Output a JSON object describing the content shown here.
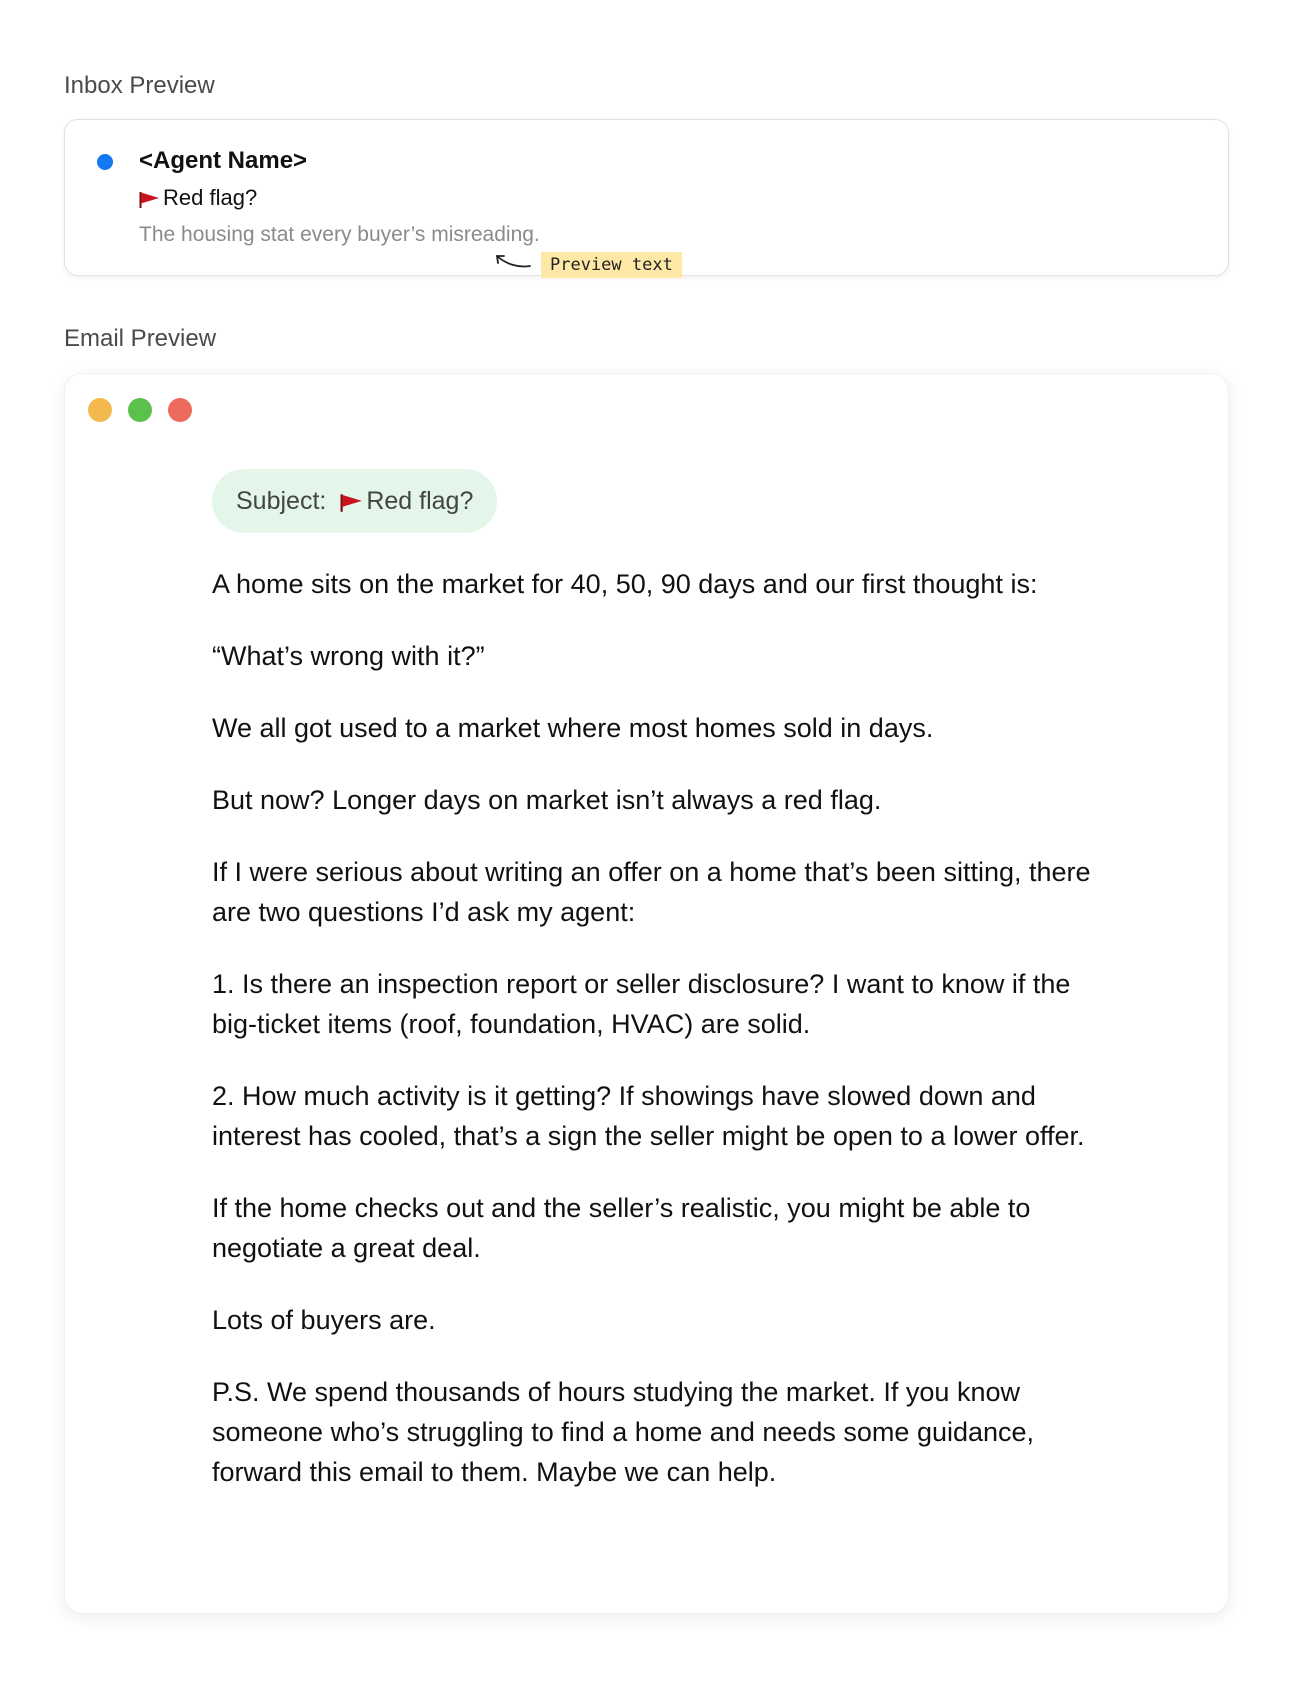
{
  "inbox": {
    "section_label": "Inbox Preview",
    "sender": "<Agent Name>",
    "subject": "Red flag?",
    "preview_text": "The housing stat every buyer’s misreading.",
    "annotation": "Preview text",
    "unread_color": "#1677f2"
  },
  "email": {
    "section_label": "Email Preview",
    "window_controls": [
      "yellow",
      "green",
      "red"
    ],
    "subject_prefix": "Subject:",
    "subject": "Red flag?",
    "paragraphs": [
      "A home sits on the market for 40, 50, 90 days and our first thought is:",
      "“What’s wrong with it?”",
      "We all got used to a market where most homes sold in days.",
      "But now? Longer days on market isn’t always a red flag.",
      "If I were serious about writing an offer on a home that’s been sitting, there are two questions I’d ask my agent:",
      "1. Is there an inspection report or seller disclosure? I want to know if the big-ticket items (roof, foundation, HVAC) are solid.",
      "2. How much activity is it getting? If showings have slowed down and interest has cooled, that’s a sign the seller might be open to a lower offer.",
      "If the home checks out and the seller’s realistic, you might be able to negotiate a great deal.",
      "Lots of buyers are.",
      "P.S. We spend thousands of hours studying the market. If you know someone who’s struggling to find a home and needs some guidance, forward this email to them. Maybe we can help."
    ]
  },
  "colors": {
    "flag": "#c8141e",
    "pill_background": "#e4f5ea",
    "annotation_background": "#fde8a6"
  }
}
